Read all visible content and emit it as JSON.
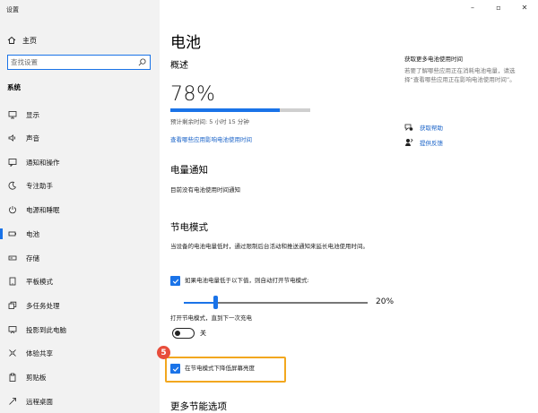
{
  "app": {
    "title": "设置"
  },
  "window": {
    "minimize": "–",
    "maximize": "▫",
    "close": "✕"
  },
  "sidebar": {
    "home": "主页",
    "search_placeholder": "查找设置",
    "section": "系统",
    "items": [
      {
        "label": "显示",
        "icon": "display-icon"
      },
      {
        "label": "声音",
        "icon": "sound-icon"
      },
      {
        "label": "通知和操作",
        "icon": "notification-icon"
      },
      {
        "label": "专注助手",
        "icon": "moon-icon"
      },
      {
        "label": "电源和睡眠",
        "icon": "power-icon"
      },
      {
        "label": "电池",
        "icon": "battery-icon",
        "active": true
      },
      {
        "label": "存储",
        "icon": "storage-icon"
      },
      {
        "label": "平板模式",
        "icon": "tablet-icon"
      },
      {
        "label": "多任务处理",
        "icon": "multitask-icon"
      },
      {
        "label": "投影到此电脑",
        "icon": "project-icon"
      },
      {
        "label": "体验共享",
        "icon": "share-icon"
      },
      {
        "label": "剪贴板",
        "icon": "clipboard-icon"
      },
      {
        "label": "远程桌面",
        "icon": "remote-icon"
      }
    ]
  },
  "main": {
    "title": "电池",
    "overview": {
      "heading": "概述",
      "percent": "78%",
      "level": 0.78,
      "remaining": "预计剩余时间: 5 小时 15 分钟",
      "link": "查看哪些应用影响电池使用时间"
    },
    "notifications": {
      "heading": "电量通知",
      "text": "目前没有电池使用时间通知"
    },
    "saver": {
      "heading": "节电模式",
      "desc": "当设备的电池电量低时，通过限制后台活动和推送通知来延长电池使用时间。",
      "auto_label": "如果电池电量低于以下值，则自动打开节电模式:",
      "auto_checked": true,
      "slider_value": "20%",
      "slider_level": 0.2,
      "toggle_label": "打开节电模式，直到下一次充电",
      "toggle_state": "关",
      "toggle_on": false,
      "dim_label": "在节电模式下降低屏幕亮度",
      "dim_checked": true,
      "step_badge": "5"
    },
    "more": {
      "heading": "更多节能选项"
    }
  },
  "right_pane": {
    "title": "获取更多电池使用时间",
    "text": "若要了解哪些应用正在消耗电池电量，请选择“查看哪些应用正在影响电池使用时间”。",
    "links": [
      {
        "label": "获取帮助",
        "icon": "help-icon"
      },
      {
        "label": "提供反馈",
        "icon": "feedback-icon"
      }
    ]
  },
  "colors": {
    "accent": "#1a73e8",
    "highlight": "#f2a71f",
    "badge": "#e84d3b",
    "sidebar_bg": "#f2f2f2"
  }
}
